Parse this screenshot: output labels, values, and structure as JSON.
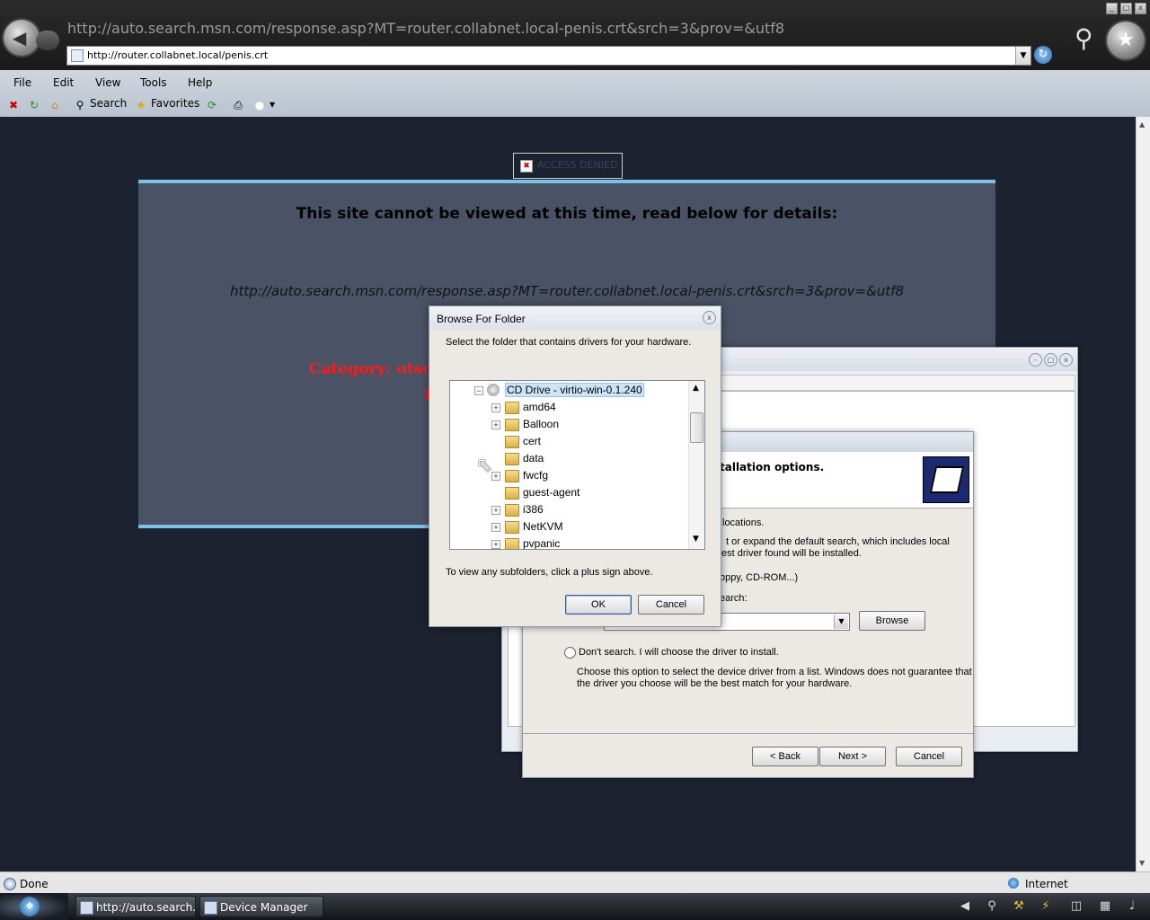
{
  "browser": {
    "title_url": "http://auto.search.msn.com/response.asp?MT=router.collabnet.local-penis.crt&srch=3&prov=&utf8",
    "address": "http://router.collabnet.local/penis.crt"
  },
  "menu": {
    "items": [
      "File",
      "Edit",
      "View",
      "Tools",
      "Help"
    ]
  },
  "toolbar": {
    "search_label": "Search",
    "favorites_label": "Favorites"
  },
  "page": {
    "img_alt": "ACCESS DENIED",
    "heading": "This site cannot be viewed at this time, read below for details:",
    "blocked_url": "http://auto.search.msn.com/response.asp?MT=router.collabnet.local-penis.crt&srch=3&prov=&utf8",
    "category_label": "Category: otsd",
    "category_line2": "I"
  },
  "wizard": {
    "heading": "tallation options.",
    "line_locations": "locations.",
    "line_expand": "t or expand the default search, which includes local",
    "line_best": "est driver found will be installed.",
    "line_media": "oppy, CD-ROM...)",
    "line_search": "earch:",
    "browse": "Browse",
    "dont_search": "Don't search. I will choose the driver to install.",
    "choose_1": "Choose this option to select the device driver from a list.  Windows does not guarantee that",
    "choose_2": "the driver you choose will be the best match for your hardware.",
    "back": "< Back",
    "next": "Next >",
    "cancel": "Cancel"
  },
  "browse_dialog": {
    "title": "Browse For Folder",
    "instruction": "Select the folder that contains drivers for your hardware.",
    "root": "CD Drive - virtio-win-0.1.240",
    "folders": [
      {
        "name": "amd64",
        "expandable": true
      },
      {
        "name": "Balloon",
        "expandable": true
      },
      {
        "name": "cert",
        "expandable": false
      },
      {
        "name": "data",
        "expandable": false
      },
      {
        "name": "fwcfg",
        "expandable": true
      },
      {
        "name": "guest-agent",
        "expandable": false
      },
      {
        "name": "i386",
        "expandable": true
      },
      {
        "name": "NetKVM",
        "expandable": true
      },
      {
        "name": "pvpanic",
        "expandable": true
      }
    ],
    "hint": "To view any subfolders, click a plus sign above.",
    "ok": "OK",
    "cancel": "Cancel"
  },
  "status": {
    "text": "Done",
    "zone": "Internet"
  },
  "taskbar": {
    "tasks": [
      "http://auto.search....",
      "Device Manager"
    ]
  },
  "colors": {
    "page_bg": "#1c2230",
    "panel_bg": "#4a5366",
    "panel_border": "#7fc0ea",
    "category": "#ff1a1a"
  }
}
